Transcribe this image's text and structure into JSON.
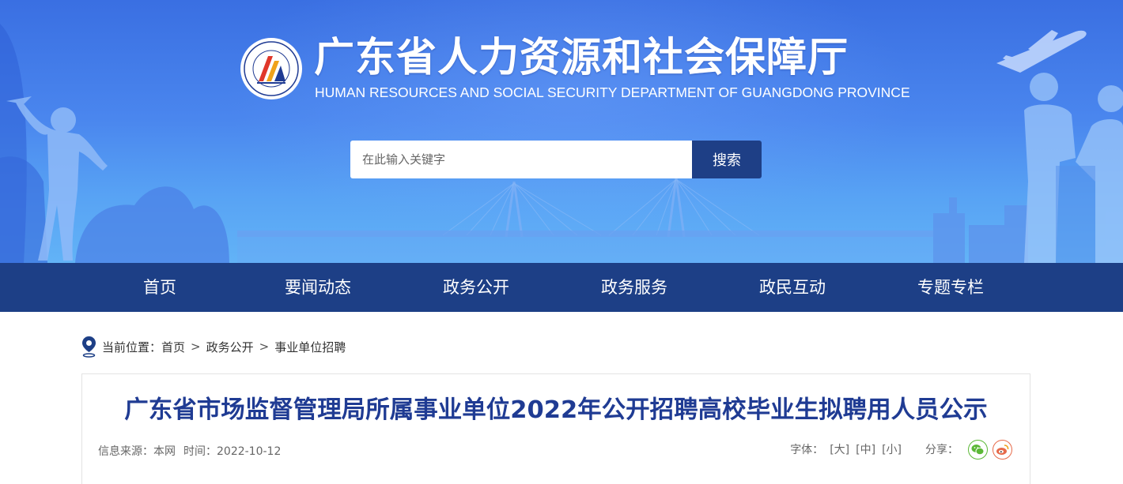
{
  "header": {
    "title": "广东省人力资源和社会保障厅",
    "subtitle": "HUMAN RESOURCES AND SOCIAL SECURITY DEPARTMENT OF GUANGDONG PROVINCE",
    "logo_icon": "department-seal-logo",
    "search": {
      "placeholder": "在此输入关键字",
      "button_label": "搜索"
    }
  },
  "nav": {
    "items": [
      "首页",
      "要闻动态",
      "政务公开",
      "政务服务",
      "政民互动",
      "专题专栏"
    ]
  },
  "breadcrumb": {
    "icon": "location-pin-icon",
    "prefix": "当前位置：",
    "separator": ">",
    "items": [
      "首页",
      "政务公开",
      "事业单位招聘"
    ]
  },
  "article": {
    "title": "广东省市场监督管理局所属事业单位2022年公开招聘高校毕业生拟聘用人员公示",
    "source_label": "信息来源：",
    "source": "本网",
    "time_label": "时间：",
    "date": "2022-10-12",
    "font_label": "字体：",
    "font_sizes": [
      "[大]",
      "[中]",
      "[小]"
    ],
    "share_label": "分享：",
    "share_icons": [
      "wechat-icon",
      "weibo-icon"
    ]
  },
  "colors": {
    "nav_bg": "#1d3f86",
    "search_button_bg": "#1e3f86",
    "title_color": "#1f3b93",
    "banner_top": "#3a6fe2",
    "banner_bottom": "#62b3f7"
  }
}
